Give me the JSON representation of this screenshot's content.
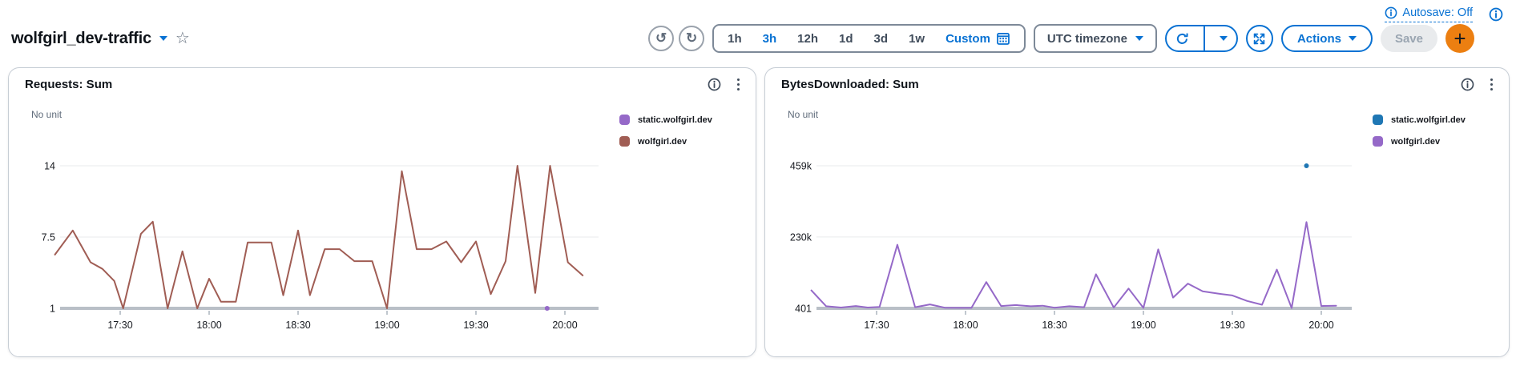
{
  "header": {
    "title": "wolfgirl_dev-traffic",
    "autosave_label": "Autosave: Off",
    "time_ranges": [
      "1h",
      "3h",
      "12h",
      "1d",
      "3d",
      "1w"
    ],
    "selected_range": "3h",
    "custom_label": "Custom",
    "timezone_label": "UTC timezone",
    "actions_label": "Actions",
    "save_label": "Save",
    "add_label": "+",
    "icons": {
      "undo": "↺",
      "redo": "↻",
      "star": "☆",
      "info": "info-circle",
      "calendar": "calendar-grid",
      "refresh": "circular-arrow",
      "fullscreen": "expand-arrows",
      "kebab": "vertical-ellipsis",
      "caret": "▼"
    }
  },
  "colors": {
    "accent": "#0972d3",
    "add_button": "#ec7f11",
    "disabled_bg": "#e9ebed",
    "disabled_text": "#9aa5b1",
    "gridline": "#e9ebed",
    "baseline": "#b9bfc7",
    "series_purple": "#9569c8",
    "series_brown": "#a05d54",
    "series_blue": "#1f77b4"
  },
  "chart_data": [
    {
      "type": "line",
      "title": "Requests: Sum",
      "unit_label": "No unit",
      "legend_position": "right",
      "grid": true,
      "xticks": [
        "17:30",
        "18:00",
        "18:30",
        "19:00",
        "19:30",
        "20:00"
      ],
      "x_range": [
        "17:08",
        "20:10"
      ],
      "yticks": [
        {
          "label": "1",
          "value": 1
        },
        {
          "label": "7.5",
          "value": 7.5
        },
        {
          "label": "14",
          "value": 14
        }
      ],
      "ylim": [
        1,
        14
      ],
      "series": [
        {
          "name": "static.wolfgirl.dev",
          "color": "#9569c8",
          "style": "points",
          "points": [
            [
              "19:54",
              1
            ]
          ]
        },
        {
          "name": "wolfgirl.dev",
          "color": "#a05d54",
          "style": "line",
          "points": [
            [
              "17:08",
              5.9
            ],
            [
              "17:14",
              8.1
            ],
            [
              "17:20",
              5.2
            ],
            [
              "17:24",
              4.6
            ],
            [
              "17:28",
              3.5
            ],
            [
              "17:31",
              1
            ],
            [
              "17:37",
              7.8
            ],
            [
              "17:41",
              8.9
            ],
            [
              "17:46",
              1
            ],
            [
              "17:51",
              6.2
            ],
            [
              "17:56",
              1
            ],
            [
              "18:00",
              3.7
            ],
            [
              "18:04",
              1.6
            ],
            [
              "18:09",
              1.6
            ],
            [
              "18:13",
              7
            ],
            [
              "18:21",
              7
            ],
            [
              "18:25",
              2.2
            ],
            [
              "18:30",
              8.1
            ],
            [
              "18:34",
              2.2
            ],
            [
              "18:39",
              6.4
            ],
            [
              "18:44",
              6.4
            ],
            [
              "18:49",
              5.3
            ],
            [
              "18:55",
              5.3
            ],
            [
              "19:00",
              1
            ],
            [
              "19:05",
              13.5
            ],
            [
              "19:10",
              6.4
            ],
            [
              "19:15",
              6.4
            ],
            [
              "19:20",
              7.1
            ],
            [
              "19:25",
              5.2
            ],
            [
              "19:30",
              7.1
            ],
            [
              "19:35",
              2.3
            ],
            [
              "19:40",
              5.3
            ],
            [
              "19:44",
              14
            ],
            [
              "19:50",
              2.4
            ],
            [
              "19:55",
              14
            ],
            [
              "20:01",
              5.2
            ],
            [
              "20:06",
              4
            ]
          ]
        }
      ]
    },
    {
      "type": "line",
      "title": "BytesDownloaded: Sum",
      "unit_label": "No unit",
      "legend_position": "right",
      "grid": true,
      "xticks": [
        "17:30",
        "18:00",
        "18:30",
        "19:00",
        "19:30",
        "20:00"
      ],
      "x_range": [
        "17:08",
        "20:10"
      ],
      "yticks": [
        {
          "label": "401",
          "value": 401
        },
        {
          "label": "230k",
          "value": 230000
        },
        {
          "label": "459k",
          "value": 459000
        }
      ],
      "ylim": [
        401,
        459000
      ],
      "series": [
        {
          "name": "static.wolfgirl.dev",
          "color": "#1f77b4",
          "style": "points",
          "points": [
            [
              "19:55",
              459000
            ]
          ]
        },
        {
          "name": "wolfgirl.dev",
          "color": "#9569c8",
          "style": "line",
          "points": [
            [
              "17:08",
              58000
            ],
            [
              "17:13",
              7000
            ],
            [
              "17:18",
              3000
            ],
            [
              "17:23",
              8000
            ],
            [
              "17:27",
              3000
            ],
            [
              "17:31",
              5000
            ],
            [
              "17:37",
              205000
            ],
            [
              "17:43",
              4000
            ],
            [
              "17:48",
              13000
            ],
            [
              "17:53",
              2500
            ],
            [
              "17:58",
              2000
            ],
            [
              "18:02",
              2000
            ],
            [
              "18:07",
              85000
            ],
            [
              "18:12",
              8000
            ],
            [
              "18:17",
              11000
            ],
            [
              "18:22",
              7000
            ],
            [
              "18:26",
              9000
            ],
            [
              "18:30",
              2500
            ],
            [
              "18:35",
              7000
            ],
            [
              "18:40",
              4000
            ],
            [
              "18:44",
              110000
            ],
            [
              "18:50",
              3000
            ],
            [
              "18:55",
              64000
            ],
            [
              "19:00",
              2000
            ],
            [
              "19:05",
              190000
            ],
            [
              "19:10",
              35000
            ],
            [
              "19:15",
              80000
            ],
            [
              "19:20",
              55000
            ],
            [
              "19:25",
              48000
            ],
            [
              "19:30",
              42000
            ],
            [
              "19:35",
              24000
            ],
            [
              "19:40",
              12000
            ],
            [
              "19:45",
              125000
            ],
            [
              "19:50",
              1500
            ],
            [
              "19:55",
              278000
            ],
            [
              "20:00",
              8000
            ],
            [
              "20:05",
              9000
            ]
          ]
        }
      ]
    }
  ]
}
